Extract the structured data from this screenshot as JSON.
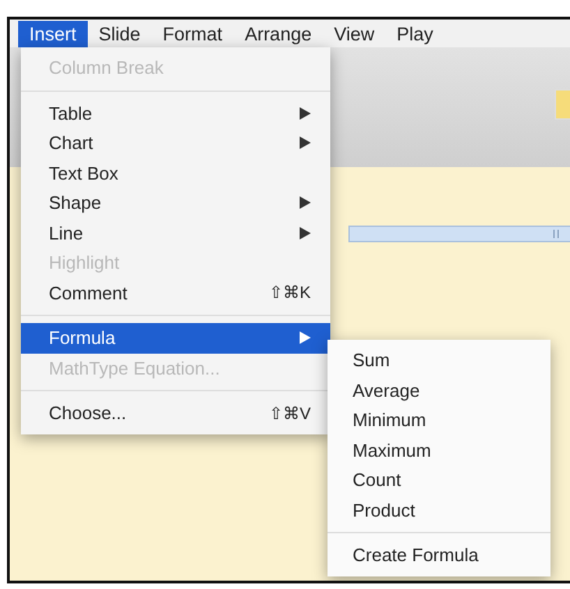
{
  "menubar": [
    {
      "label": "Insert",
      "selected": true
    },
    {
      "label": "Slide",
      "selected": false
    },
    {
      "label": "Format",
      "selected": false
    },
    {
      "label": "Arrange",
      "selected": false
    },
    {
      "label": "View",
      "selected": false
    },
    {
      "label": "Play",
      "selected": false
    }
  ],
  "menu": {
    "items": [
      {
        "kind": "item",
        "label": "Column Break",
        "disabled": true,
        "selected": false,
        "submenu": false
      },
      {
        "kind": "separator"
      },
      {
        "kind": "item",
        "label": "Table",
        "disabled": false,
        "selected": false,
        "submenu": true
      },
      {
        "kind": "item",
        "label": "Chart",
        "disabled": false,
        "selected": false,
        "submenu": true
      },
      {
        "kind": "item",
        "label": "Text Box",
        "disabled": false,
        "selected": false,
        "submenu": false
      },
      {
        "kind": "item",
        "label": "Shape",
        "disabled": false,
        "selected": false,
        "submenu": true
      },
      {
        "kind": "item",
        "label": "Line",
        "disabled": false,
        "selected": false,
        "submenu": true
      },
      {
        "kind": "item",
        "label": "Highlight",
        "disabled": true,
        "selected": false,
        "submenu": false
      },
      {
        "kind": "item",
        "label": "Comment",
        "shortcut": "⇧⌘K",
        "disabled": false,
        "selected": false,
        "submenu": false
      },
      {
        "kind": "separator"
      },
      {
        "kind": "item",
        "label": "Formula",
        "disabled": false,
        "selected": true,
        "submenu": true
      },
      {
        "kind": "item",
        "label": "MathType Equation...",
        "disabled": true,
        "selected": false,
        "submenu": false
      },
      {
        "kind": "separator"
      },
      {
        "kind": "item",
        "label": "Choose...",
        "shortcut": "⇧⌘V",
        "disabled": false,
        "selected": false,
        "submenu": false
      }
    ]
  },
  "submenu": {
    "items": [
      {
        "kind": "item",
        "label": "Sum"
      },
      {
        "kind": "item",
        "label": "Average"
      },
      {
        "kind": "item",
        "label": "Minimum"
      },
      {
        "kind": "item",
        "label": "Maximum"
      },
      {
        "kind": "item",
        "label": "Count"
      },
      {
        "kind": "item",
        "label": "Product"
      },
      {
        "kind": "separator"
      },
      {
        "kind": "item",
        "label": "Create Formula"
      }
    ]
  }
}
